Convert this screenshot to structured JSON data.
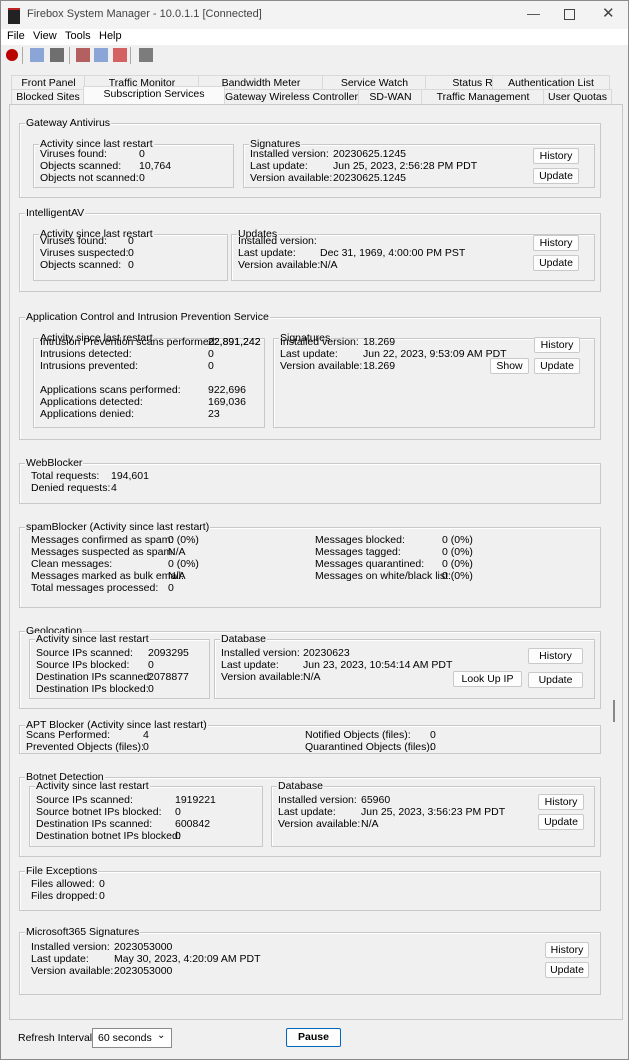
{
  "window": {
    "title": "Firebox System Manager - 10.0.1.1 [Connected]"
  },
  "menu": [
    "File",
    "View",
    "Tools",
    "Help"
  ],
  "toolbar_icons": [
    "stop-icon",
    "report-icon",
    "window-icon",
    "user-icon",
    "grid-icon",
    "chart-icon",
    "document-icon"
  ],
  "tabs": {
    "row1": [
      "Front Panel",
      "Traffic Monitor",
      "Bandwidth Meter",
      "Service Watch",
      "Status Report",
      "Authentication List"
    ],
    "row2": [
      "Blocked Sites",
      "Subscription Services",
      "Gateway Wireless Controller",
      "SD-WAN",
      "Traffic Management",
      "User Quotas"
    ],
    "active": "Subscription Services"
  },
  "gav": {
    "title": "Gateway Antivirus",
    "activity_title": "Activity since last restart",
    "activity": [
      [
        "Viruses found:",
        "0"
      ],
      [
        "Objects scanned:",
        "10,764"
      ],
      [
        "Objects not scanned:",
        "0"
      ]
    ],
    "sig_title": "Signatures",
    "sig": [
      [
        "Installed version:",
        "20230625.1245"
      ],
      [
        "Last update:",
        "Jun 25, 2023, 2:56:28 PM PDT"
      ],
      [
        "Version available:",
        "20230625.1245"
      ]
    ],
    "history": "History",
    "update": "Update"
  },
  "iav": {
    "title": "IntelligentAV",
    "activity_title": "Activity since last restart",
    "activity": [
      [
        "Viruses found:",
        "0"
      ],
      [
        "Viruses suspected:",
        "0"
      ],
      [
        "Objects scanned:",
        "0"
      ]
    ],
    "sig_title": "Updates",
    "sig": [
      [
        "Installed version:",
        ""
      ],
      [
        "Last update:",
        "Dec 31, 1969, 4:00:00 PM PST"
      ],
      [
        "Version available:",
        "N/A"
      ]
    ],
    "history": "History",
    "update": "Update"
  },
  "ips": {
    "title": "Application Control and Intrusion Prevention Service",
    "activity_title": "Activity since last restart",
    "activity": [
      [
        "Intrusion Prevention scans performed:",
        "22,891,242"
      ],
      [
        "Intrusions detected:",
        "0"
      ],
      [
        "Intrusions prevented:",
        "0"
      ],
      [
        "Applications scans performed:",
        "922,696"
      ],
      [
        "Applications detected:",
        "169,036"
      ],
      [
        "Applications denied:",
        "23"
      ]
    ],
    "sig_title": "Signatures",
    "sig": [
      [
        "Installed version:",
        "18.269"
      ],
      [
        "Last update:",
        "Jun 22, 2023, 9:53:09 AM PDT"
      ],
      [
        "Version available:",
        "18.269"
      ]
    ],
    "show": "Show",
    "history": "History",
    "update": "Update"
  },
  "web": {
    "title": "WebBlocker",
    "rows": [
      [
        "Total requests:",
        "194,601"
      ],
      [
        "Denied requests:",
        "4"
      ]
    ]
  },
  "spam": {
    "title": "spamBlocker (Activity since last restart)",
    "left": [
      [
        "Messages confirmed as spam:",
        "0 (0%)"
      ],
      [
        "Messages suspected as spam:",
        "N/A"
      ],
      [
        "Clean messages:",
        "0 (0%)"
      ],
      [
        "Messages marked as bulk email:",
        "N/A"
      ],
      [
        "Total messages processed:",
        "0"
      ]
    ],
    "right": [
      [
        "Messages blocked:",
        "0 (0%)"
      ],
      [
        "Messages tagged:",
        "0 (0%)"
      ],
      [
        "Messages quarantined:",
        "0 (0%)"
      ],
      [
        "Messages on white/black list:",
        "0 (0%)"
      ]
    ]
  },
  "geo": {
    "title": "Geolocation",
    "activity_title": "Activity since last restart",
    "activity": [
      [
        "Source IPs scanned:",
        "2093295"
      ],
      [
        "Source IPs blocked:",
        "0"
      ],
      [
        "Destination IPs scanned:",
        "2078877"
      ],
      [
        "Destination IPs blocked:",
        "0"
      ]
    ],
    "db_title": "Database",
    "db": [
      [
        "Installed version:",
        "20230623"
      ],
      [
        "Last update:",
        "Jun 23, 2023, 10:54:14 AM PDT"
      ],
      [
        "Version available:",
        "N/A"
      ]
    ],
    "lookup": "Look Up IP",
    "history": "History",
    "update": "Update"
  },
  "apt": {
    "title": "APT Blocker (Activity since last restart)",
    "left": [
      [
        "Scans Performed:",
        "4"
      ],
      [
        "Prevented Objects (files):",
        "0"
      ]
    ],
    "right": [
      [
        "Notified Objects (files):",
        "0"
      ],
      [
        "Quarantined Objects (files):",
        "0"
      ]
    ]
  },
  "botnet": {
    "title": "Botnet Detection",
    "activity_title": "Activity since last restart",
    "activity": [
      [
        "Source IPs scanned:",
        "1919221"
      ],
      [
        "Source botnet IPs blocked:",
        "0"
      ],
      [
        "Destination IPs scanned:",
        "600842"
      ],
      [
        "Destination botnet IPs blocked:",
        "0"
      ]
    ],
    "db_title": "Database",
    "db": [
      [
        "Installed version:",
        "65960"
      ],
      [
        "Last update:",
        "Jun 25, 2023, 3:56:23 PM PDT"
      ],
      [
        "Version available:",
        "N/A"
      ]
    ],
    "history": "History",
    "update": "Update"
  },
  "fileexc": {
    "title": "File Exceptions",
    "rows": [
      [
        "Files allowed:",
        "0"
      ],
      [
        "Files dropped:",
        "0"
      ]
    ]
  },
  "m365": {
    "title": "Microsoft365 Signatures",
    "rows": [
      [
        "Installed version:",
        "2023053000"
      ],
      [
        "Last update:",
        "May 30, 2023, 4:20:09 AM PDT"
      ],
      [
        "Version available:",
        "2023053000"
      ]
    ],
    "history": "History",
    "update": "Update"
  },
  "footer": {
    "refresh_label": "Refresh Interval:",
    "refresh_value": "60 seconds",
    "pause": "Pause"
  }
}
